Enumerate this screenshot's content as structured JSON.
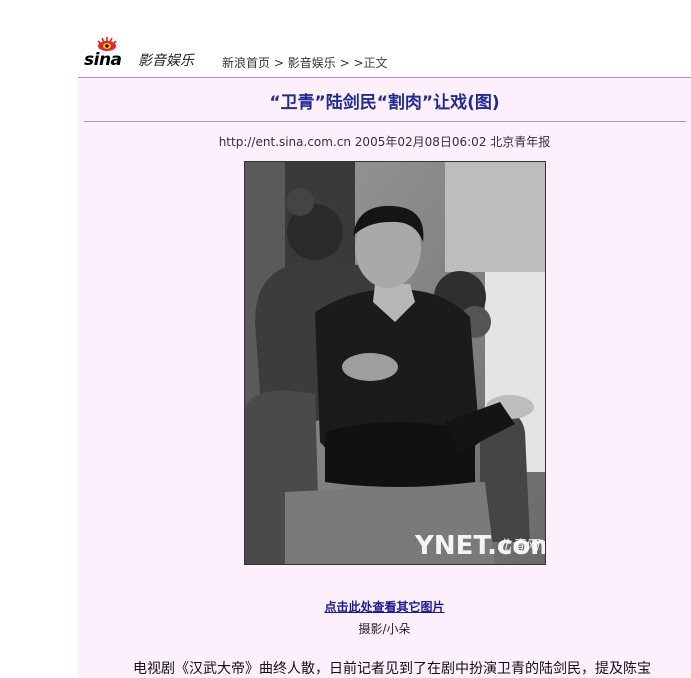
{
  "header": {
    "logo_text": "sina",
    "channel": "影音娱乐",
    "breadcrumb": {
      "home": "新浪首页",
      "sep1": ">",
      "channel": "影音娱乐",
      "sep2": ">",
      "sep3": ">",
      "current": "正文"
    }
  },
  "article": {
    "title": "“卫青”陆剑民“割肉”让戏(图)",
    "meta": "http://ent.sina.com.cn 2005年02月08日06:02 北京青年报",
    "photo_watermark": "YNET.com",
    "photo_watermark_cn": "北青网",
    "more_pictures_link": "点击此处查看其它图片",
    "photo_credit": "摄影/小朵",
    "first_paragraph": "电视剧《汉武大帝》曲终人散，日前记者见到了在剧中扮演卫青的陆剑民，提及陈宝"
  },
  "colors": {
    "panel_bg": "#fdf0fd",
    "rule": "#b98bb9",
    "title": "#1e2a9c",
    "link": "#1a1a9a"
  }
}
